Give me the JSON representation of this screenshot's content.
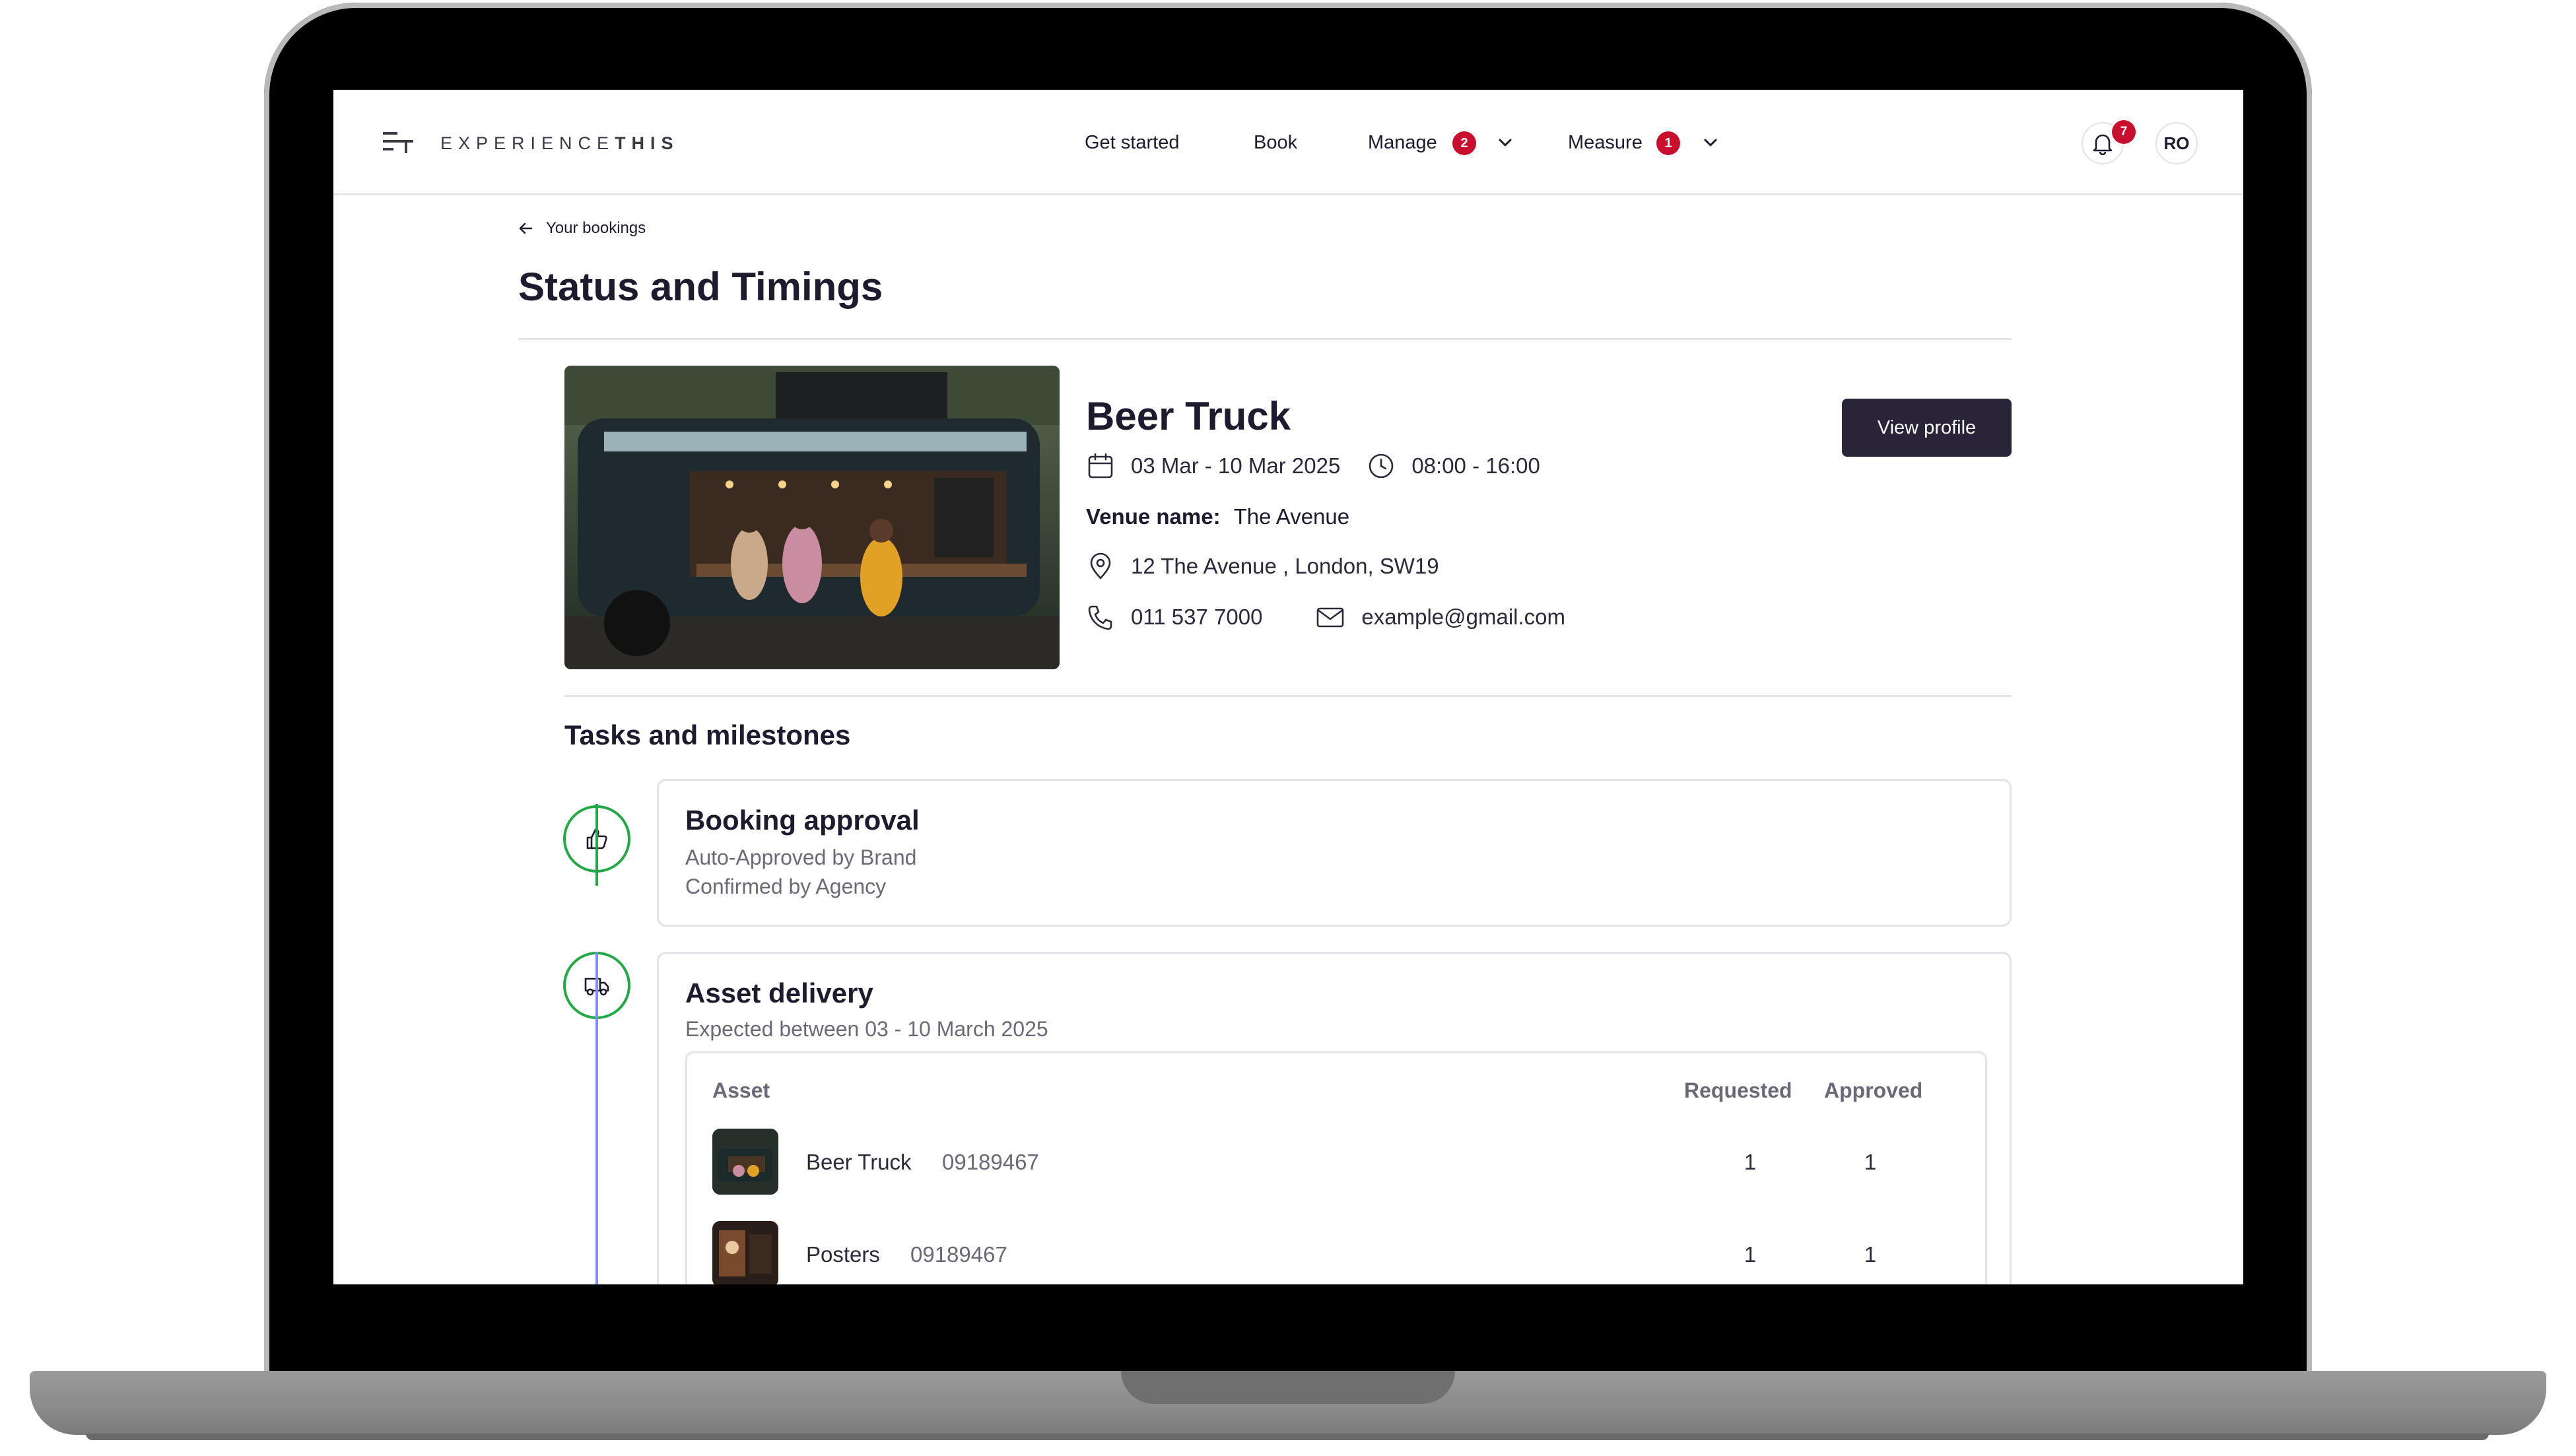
{
  "app": {
    "logo_text_light": "EXPERIENCE",
    "logo_text_bold": "THIS"
  },
  "nav": {
    "items": [
      {
        "label": "Get started"
      },
      {
        "label": "Book"
      },
      {
        "label": "Manage",
        "badge": "2"
      },
      {
        "label": "Measure",
        "badge": "1"
      }
    ],
    "notifications_badge": "7",
    "avatar_initials": "RO"
  },
  "page": {
    "back_label": "Your bookings",
    "title": "Status and Timings"
  },
  "booking": {
    "name": "Beer Truck",
    "dates": "03 Mar - 10 Mar 2025",
    "hours": "08:00 - 16:00",
    "venue_label": "Venue name:",
    "venue_name": "The Avenue",
    "address": "12 The Avenue , London, SW19",
    "phone": "011 537 7000",
    "email": "example@gmail.com",
    "view_profile_label": "View profile"
  },
  "tasks": {
    "section_title": "Tasks and milestones",
    "approval": {
      "title": "Booking approval",
      "lines": [
        "Auto-Approved by Brand",
        "Confirmed by Agency"
      ]
    },
    "delivery": {
      "title": "Asset delivery",
      "subtitle": "Expected between 03 - 10 March 2025",
      "columns": {
        "asset": "Asset",
        "requested": "Requested",
        "approved": "Approved"
      },
      "rows": [
        {
          "name": "Beer Truck",
          "code": "09189467",
          "requested": "1",
          "approved": "1"
        },
        {
          "name": "Posters",
          "code": "09189467",
          "requested": "1",
          "approved": "1"
        }
      ]
    }
  },
  "colors": {
    "primary_button": "#2a2438",
    "badge_red": "#c8102e",
    "step_green": "#22a845",
    "timeline_blue": "#7f8ef0"
  }
}
